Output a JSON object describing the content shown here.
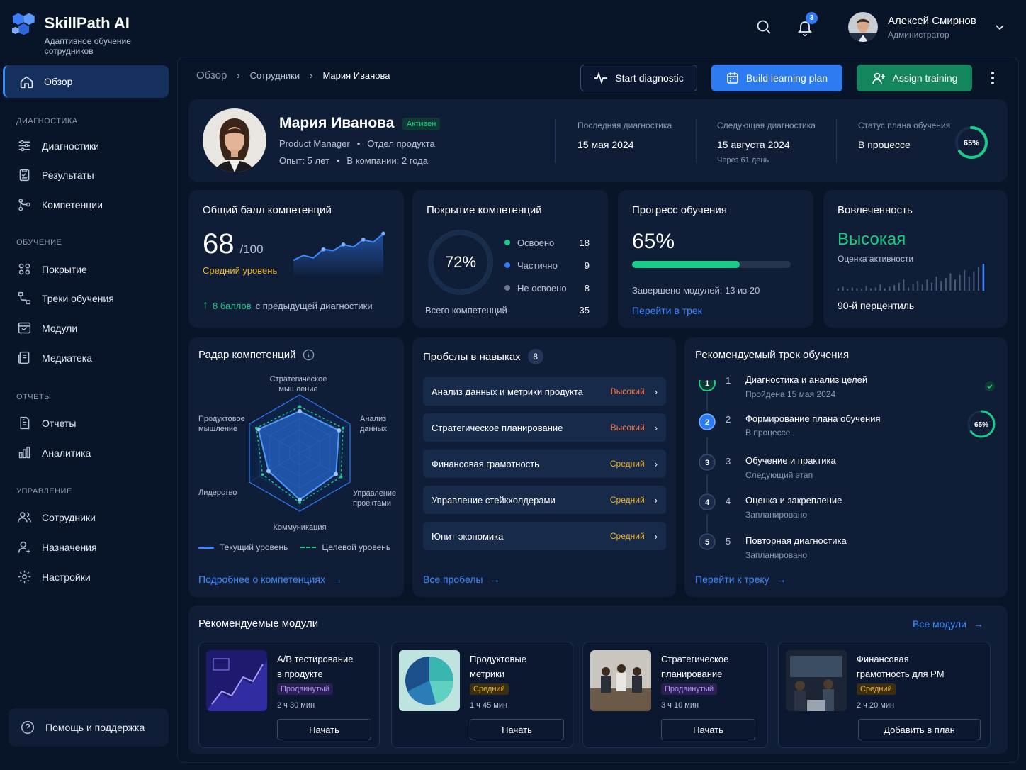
{
  "brand": {
    "title": "SkillPath AI",
    "subtitle": "Адаптивное обучение сотрудников"
  },
  "sidebar": {
    "active": "Обзор",
    "sections": [
      {
        "title": "ДИАГНОСТИКА",
        "items": [
          "Диагностики",
          "Результаты",
          "Компетенции"
        ]
      },
      {
        "title": "ОБУЧЕНИЕ",
        "items": [
          "Покрытие",
          "Треки обучения",
          "Модули",
          "Медиатека"
        ]
      },
      {
        "title": "ОТЧЕТЫ",
        "items": [
          "Отчеты",
          "Аналитика"
        ]
      },
      {
        "title": "УПРАВЛЕНИЕ",
        "items": [
          "Сотрудники",
          "Назначения",
          "Настройки"
        ]
      }
    ],
    "help": "Помощь и поддержка"
  },
  "topbar": {
    "notifications": "3",
    "user_name": "Алексей Смирнов",
    "user_role": "Администратор"
  },
  "breadcrumb": [
    "Обзор",
    "Сотрудники",
    "Мария Иванова"
  ],
  "actions": {
    "diagnostic": "Start diagnostic",
    "plan": "Build learning plan",
    "assign": "Assign training"
  },
  "profile": {
    "name": "Мария Иванова",
    "status": "Активен",
    "position": "Product Manager",
    "department": "Отдел продукта",
    "experience": "Опыт: 5 лет",
    "tenure": "В компании: 2 года",
    "last_diag_label": "Последняя диагностика",
    "last_diag": "15 мая 2024",
    "next_diag_label": "Следующая диагностика",
    "next_diag": "15 августа 2024",
    "next_diag_sub": "Через 61 день",
    "plan_label": "Статус плана обучения",
    "plan_status": "В процессе",
    "plan_pct_text": "65%",
    "plan_pct": 0.65
  },
  "score": {
    "title": "Общий балл компетенций",
    "value": "68",
    "max": "/100",
    "level": "Средний уровень",
    "delta": "8 баллов",
    "delta_text": "с предыдущей диагностики",
    "trend": [
      22,
      30,
      26,
      40,
      38,
      48,
      44,
      56,
      52,
      66
    ]
  },
  "coverage": {
    "title": "Покрытие компетенций",
    "pct": "72%",
    "mastered_label": "Освоено",
    "mastered": "18",
    "partial_label": "Частично",
    "partial": "9",
    "none_label": "Не освоено",
    "none": "8",
    "total_label": "Всего компетенций",
    "total": "35",
    "colors": {
      "mastered": "#1bcc87",
      "partial": "#2f7bf5",
      "none": "#6b7790"
    }
  },
  "progress": {
    "title": "Прогресс обучения",
    "value": "65%",
    "fraction": 0.68,
    "modules": "Завершено модулей: 13 из 20",
    "link": "Перейти в трек"
  },
  "engagement": {
    "title": "Вовлеченность",
    "level": "Высокая",
    "sub": "Оценка активности",
    "percentile": "90-й перцентиль",
    "bars": [
      3,
      5,
      2,
      4,
      3,
      2,
      6,
      3,
      4,
      8,
      3,
      5,
      7,
      10,
      14,
      4,
      9,
      12,
      8,
      14,
      10,
      18,
      12,
      16,
      22,
      14,
      20,
      26,
      18,
      24,
      30,
      34
    ]
  },
  "radar": {
    "title": "Радар компетенций",
    "axes": [
      [
        "Стратегическое",
        "мышление"
      ],
      [
        "Анализ",
        "данных"
      ],
      [
        "Управление",
        "проектами"
      ],
      [
        "Коммуникация"
      ],
      [
        "Лидерство"
      ],
      [
        "Продуктовое",
        "мышление"
      ]
    ],
    "current": [
      0.72,
      0.78,
      0.72,
      0.8,
      0.62,
      0.82
    ],
    "target": [
      0.8,
      0.86,
      0.82,
      0.85,
      0.74,
      0.86
    ],
    "legend_current": "Текущий уровень",
    "legend_target": "Целевой уровень",
    "link": "Подробнее о компетенциях"
  },
  "gaps": {
    "title": "Пробелы в навыках",
    "count": "8",
    "items": [
      {
        "name": "Анализ данных и метрики продукта",
        "level": "Высокий",
        "color": "#ff7a45"
      },
      {
        "name": "Стратегическое планирование",
        "level": "Высокий",
        "color": "#ff7a45"
      },
      {
        "name": "Финансовая грамотность",
        "level": "Средний",
        "color": "#f0b429"
      },
      {
        "name": "Управление стейкхолдерами",
        "level": "Средний",
        "color": "#f0b429"
      },
      {
        "name": "Юнит-экономика",
        "level": "Средний",
        "color": "#f0b429"
      }
    ],
    "link": "Все пробелы"
  },
  "track": {
    "title": "Рекомендуемый трек обучения",
    "steps": [
      {
        "n": "1",
        "title": "Диагностика и анализ целей",
        "sub": "Пройдена 15 мая 2024"
      },
      {
        "n": "2",
        "title": "Формирование плана обучения",
        "sub": "В процессе",
        "pct": "65%"
      },
      {
        "n": "3",
        "title": "Обучение и практика",
        "sub": "Следующий этап"
      },
      {
        "n": "4",
        "title": "Оценка и закрепление",
        "sub": "Запланировано"
      },
      {
        "n": "5",
        "title": "Повторная диагностика",
        "sub": "Запланировано"
      }
    ],
    "step2_fraction": 0.65,
    "link": "Перейти к треку"
  },
  "modules": {
    "title": "Рекомендуемые модули",
    "all": "Все модули",
    "items": [
      {
        "title1": "A/B тестирование",
        "title2": "в продукте",
        "tag": "Продвинутый",
        "duration": "2 ч 30 мин",
        "action": "Начать"
      },
      {
        "title1": "Продуктовые",
        "title2": "метрики",
        "tag": "Средний",
        "duration": "1 ч 45 мин",
        "action": "Начать"
      },
      {
        "title1": "Стратегическое",
        "title2": "планирование",
        "tag": "Продвинутый",
        "duration": "3 ч 10 мин",
        "action": "Начать"
      },
      {
        "title1": "Финансовая",
        "title2": "грамотность для PM",
        "tag": "Средний",
        "duration": "2 ч 20 мин",
        "action": "Добавить в план"
      }
    ]
  }
}
